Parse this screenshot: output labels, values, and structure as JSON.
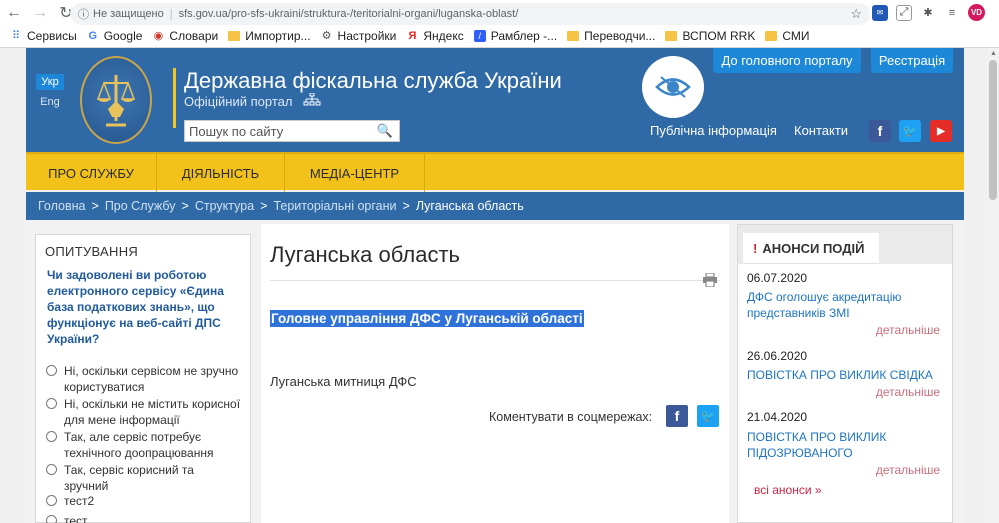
{
  "browser": {
    "security_label": "Не защищено",
    "url": "sfs.gov.ua/pro-sfs-ukraini/struktura-/teritorialni-organi/luganska-oblast/",
    "bookmarks": [
      {
        "label": "Сервисы",
        "icon": "apps-icon"
      },
      {
        "label": "Google",
        "icon": "google-icon"
      },
      {
        "label": "Словари",
        "icon": "dictionary-icon"
      },
      {
        "label": "Импортир...",
        "icon": "folder-icon"
      },
      {
        "label": "Настройки",
        "icon": "gear-icon"
      },
      {
        "label": "Яндекс",
        "icon": "yandex-icon"
      },
      {
        "label": "Рамблер -...",
        "icon": "rambler-icon"
      },
      {
        "label": "Переводчи...",
        "icon": "folder-icon"
      },
      {
        "label": "ВСПОМ RRK",
        "icon": "folder-icon"
      },
      {
        "label": "СМИ",
        "icon": "folder-icon"
      }
    ],
    "avatar_initials": "VD"
  },
  "header": {
    "lang_active": "Укр",
    "lang_other": "Eng",
    "title": "Державна фіскальна служба України",
    "subtitle": "Офіційний портал",
    "search_placeholder": "Пошук по сайту",
    "btn_portal": "До головного порталу",
    "btn_register": "Реєстрація",
    "link_public": "Публічна інформація",
    "link_contacts": "Контакти"
  },
  "menu": [
    "ПРО СЛУЖБУ",
    "ДІЯЛЬНІСТЬ",
    "МЕДІА-ЦЕНТР"
  ],
  "breadcrumbs": [
    "Головна",
    "Про Службу",
    "Структура",
    "Територіальні органи",
    "Луганська область"
  ],
  "poll": {
    "title": "ОПИТУВАННЯ",
    "question": "Чи задоволені ви роботою електронного сервісу «Єдина база податкових знань», що функціонує на веб-сайті ДПС України?",
    "options": [
      "Ні, оскільки сервісом не зручно користуватися",
      "Ні, оскільки не містить корисної для мене інформації",
      "Так, але сервіс потребує технічного доопрацювання",
      "Так, сервіс корисний та зручний",
      "тест2",
      "тест"
    ]
  },
  "main": {
    "title": "Луганська область",
    "highlight_link": "Головне управління ДФС у Луганській області",
    "customs": "Луганська митниця ДФС",
    "share_label": "Коментувати в соцмережах:"
  },
  "news": {
    "title": "АНОНСИ ПОДІЙ",
    "items": [
      {
        "date": "06.07.2020",
        "text": "ДФС оголошує акредитацію представників ЗМІ",
        "more": "детальніше"
      },
      {
        "date": "26.06.2020",
        "text": "ПОВІСТКА ПРО ВИКЛИК СВІДКА",
        "more": "детальніше"
      },
      {
        "date": "21.04.2020",
        "text": "ПОВІСТКА ПРО ВИКЛИК ПІДОЗРЮВАНОГО",
        "more": "детальніше"
      }
    ],
    "all_label": "всі анонси »"
  },
  "colors": {
    "header_blue": "#2f6aa6",
    "menu_yellow": "#f2c21b",
    "accent_blue": "#1e88d8",
    "highlight": "#2f72d9"
  }
}
